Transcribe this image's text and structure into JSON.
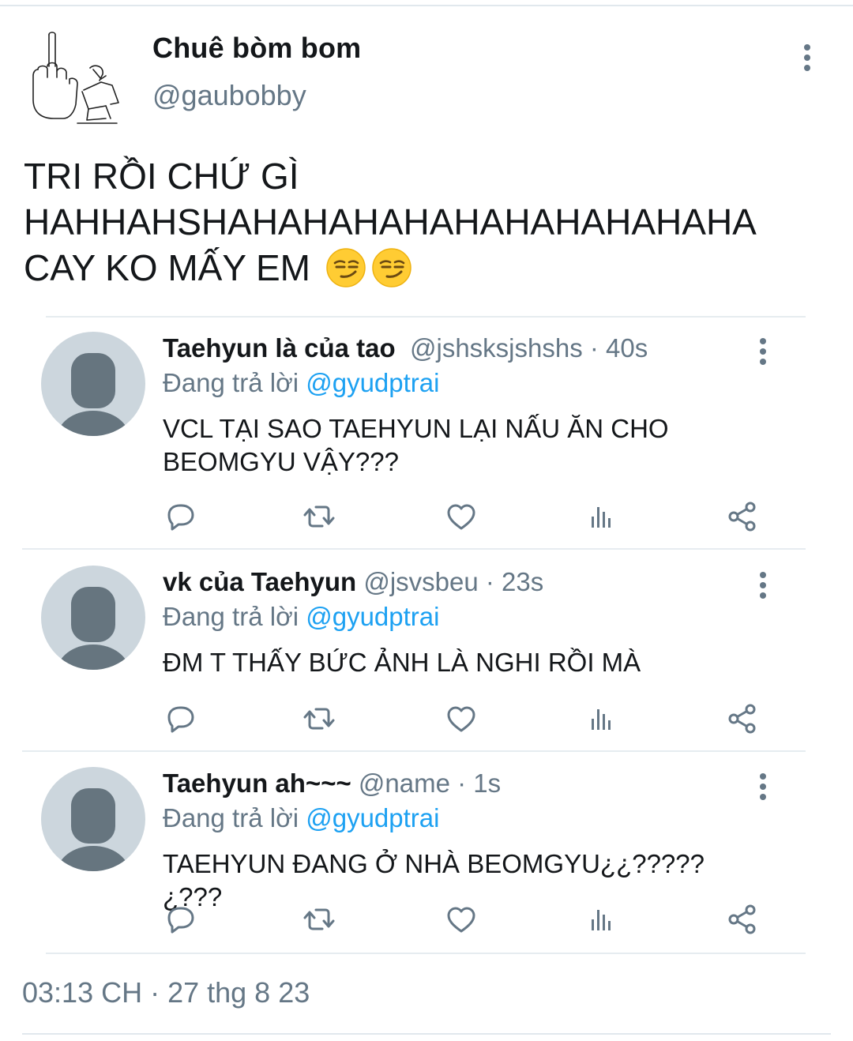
{
  "tweet": {
    "author_name": "Chuê bòm bom",
    "author_handle": "@gaubobby",
    "body_lines": [
      "TRI RỒI CHỨ GÌ",
      "HAHHAHSHAHAHAHAHAHAHAHAHAHAHA",
      "CAY KO MẤY EM"
    ],
    "body_emoji": [
      "smirking-face",
      "smirking-face"
    ],
    "timestamp": "03:13 CH · 27 thg 8 23"
  },
  "replies": [
    {
      "name": "Taehyun là của tao",
      "meta": "@jshsksjshshs · 40s",
      "replying_prefix": "Đang trả lời",
      "mention": "@gyudptrai",
      "text": "VCL TẠI SAO TAEHYUN LẠI NẤU ĂN CHO BEOMGYU VẬY???"
    },
    {
      "name": "vk của Taehyun",
      "meta": "@jsvsbeu · 23s",
      "replying_prefix": "Đang trả lời",
      "mention": "@gyudptrai",
      "text": "ĐM T THẤY BỨC ẢNH LÀ NGHI RỒI MÀ"
    },
    {
      "name": "Taehyun ah~~~",
      "meta": "@name · 1s",
      "replying_prefix": "Đang trả lời",
      "mention": "@gyudptrai",
      "text": "TAEHYUN ĐANG Ở NHÀ BEOMGYU¿¿????? ¿???"
    }
  ],
  "icons": {
    "reply": "reply-icon",
    "retweet": "retweet-icon",
    "like": "heart-icon",
    "stats": "stats-icon",
    "share": "share-icon",
    "more": "more-vertical-icon"
  },
  "colors": {
    "text": "#14171a",
    "muted": "#657786",
    "mention": "#1da1f2",
    "avatar_bg": "#ccd6dd",
    "avatar_fg": "#66757f"
  }
}
